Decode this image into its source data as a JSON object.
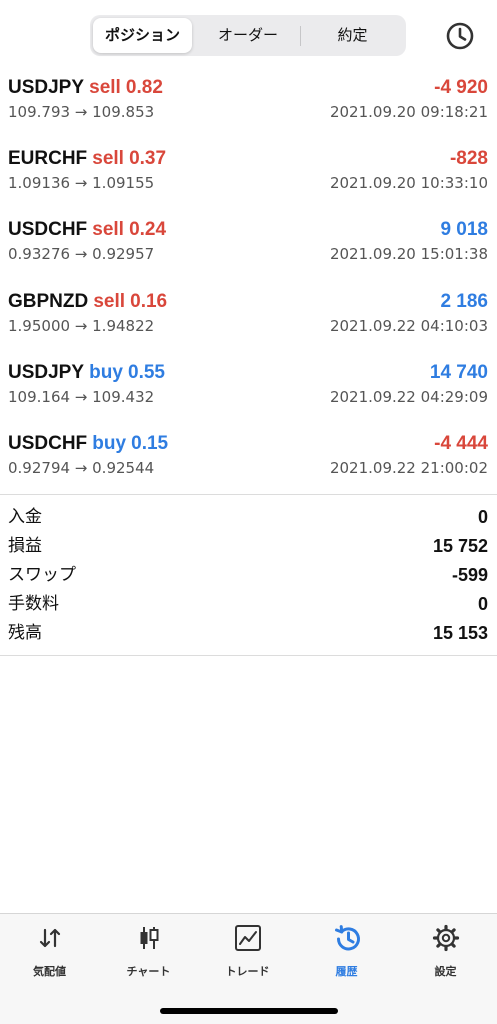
{
  "tabs": [
    {
      "label": "ポジション",
      "active": true
    },
    {
      "label": "オーダー",
      "active": false
    },
    {
      "label": "約定",
      "active": false
    }
  ],
  "history_icon": "clock-icon",
  "colors": {
    "sell": "#d9473b",
    "buy": "#2f7de1",
    "negative": "#d9473b",
    "positive": "#2f7de1"
  },
  "trades": [
    {
      "symbol": "USDJPY",
      "side": "sell",
      "volume": "0.82",
      "prices": "109.793 → 109.853",
      "profit": "-4 920",
      "time": "2021.09.20 09:18:21"
    },
    {
      "symbol": "EURCHF",
      "side": "sell",
      "volume": "0.37",
      "prices": "1.09136 → 1.09155",
      "profit": "-828",
      "time": "2021.09.20 10:33:10"
    },
    {
      "symbol": "USDCHF",
      "side": "sell",
      "volume": "0.24",
      "prices": "0.93276 → 0.92957",
      "profit": "9 018",
      "time": "2021.09.20 15:01:38"
    },
    {
      "symbol": "GBPNZD",
      "side": "sell",
      "volume": "0.16",
      "prices": "1.95000 → 1.94822",
      "profit": "2 186",
      "time": "2021.09.22 04:10:03"
    },
    {
      "symbol": "USDJPY",
      "side": "buy",
      "volume": "0.55",
      "prices": "109.164 → 109.432",
      "profit": "14 740",
      "time": "2021.09.22 04:29:09"
    },
    {
      "symbol": "USDCHF",
      "side": "buy",
      "volume": "0.15",
      "prices": "0.92794 → 0.92544",
      "profit": "-4 444",
      "time": "2021.09.22 21:00:02"
    }
  ],
  "summary": [
    {
      "label": "入金",
      "value": "0"
    },
    {
      "label": "損益",
      "value": "15 752"
    },
    {
      "label": "スワップ",
      "value": "-599"
    },
    {
      "label": "手数料",
      "value": "0"
    },
    {
      "label": "残高",
      "value": "15 153"
    }
  ],
  "tabbar": [
    {
      "label": "気配値",
      "icon": "quotes-arrows-icon",
      "active": false
    },
    {
      "label": "チャート",
      "icon": "candlestick-chart-icon",
      "active": false
    },
    {
      "label": "トレード",
      "icon": "trade-chart-icon",
      "active": false
    },
    {
      "label": "履歴",
      "icon": "history-icon",
      "active": true
    },
    {
      "label": "設定",
      "icon": "gear-icon",
      "active": false
    }
  ]
}
